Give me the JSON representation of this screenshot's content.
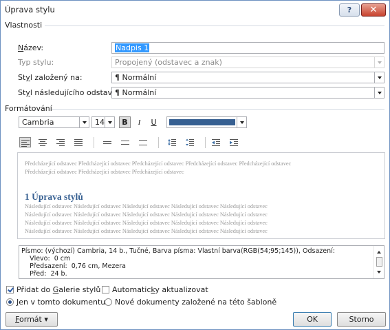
{
  "window": {
    "title": "Úprava stylu",
    "help_label": "?",
    "close_label": "✕"
  },
  "properties": {
    "heading": "Vlastnosti",
    "name_label": "Název:",
    "name_value": "Nadpis 1",
    "style_type_label": "Typ stylu:",
    "style_type_value": "Propojený (odstavec a znak)",
    "based_on_label": "Styl založený na:",
    "based_on_value": "¶  Normální",
    "next_style_label": "Styl následujícího odstavce:",
    "next_style_value": "¶  Normální"
  },
  "formatting": {
    "heading": "Formátování",
    "font": "Cambria",
    "size": "14",
    "bold_label": "B",
    "italic_label": "I",
    "underline_label": "U",
    "color": "#365f91"
  },
  "preview": {
    "prev_lines": [
      "Předcházející odstavec Předcházející odstavec Předcházející odstavec Předcházející odstavec Předcházející odstavec",
      "Předcházející odstavec Předcházející odstavec Předcházející odstavec"
    ],
    "heading_text": "1   Úprava stylů",
    "next_lines": [
      "Následující odstavec Následující odstavec Následující odstavec Následující odstavec Následující odstavec",
      "Následující odstavec Následující odstavec Následující odstavec Následující odstavec Následující odstavec",
      "Následující odstavec Následující odstavec Následující odstavec Následující odstavec Následující odstavec",
      "Následující odstavec Následující odstavec Následující odstavec Následující odstavec Následující odstavec"
    ]
  },
  "description": {
    "lines": [
      "Písmo: (výchozí) Cambria, 14 b., Tučné, Barva písma: Vlastní barva(RGB(54;95;145)), Odsazení:",
      "    Vlevo:  0 cm",
      "    Předsazení:  0,76 cm, Mezera",
      "    Před:  24 b."
    ]
  },
  "options": {
    "add_gallery_label": "Přidat do Galerie stylů",
    "auto_update_label": "Automaticky aktualizovat",
    "only_doc_label": "Jen v tomto dokumentu",
    "new_docs_label": "Nové dokumenty založené na této šabloně"
  },
  "buttons": {
    "format_label": "Formát ▾",
    "ok_label": "OK",
    "cancel_label": "Storno"
  }
}
